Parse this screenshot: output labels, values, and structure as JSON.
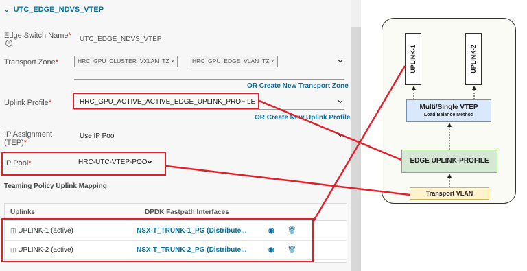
{
  "section": {
    "title": "UTC_EDGE_NDVS_VTEP"
  },
  "form": {
    "edge_switch_name": {
      "label": "Edge Switch Name",
      "value": "UTC_EDGE_NDVS_VTEP"
    },
    "transport_zone": {
      "label": "Transport Zone",
      "chips": [
        "HRC_GPU_CLUSTER_VXLAN_TZ",
        "HRC_GPU_EDGE_VLAN_TZ"
      ],
      "create_link": "OR Create New Transport Zone"
    },
    "uplink_profile": {
      "label": "Uplink Profile",
      "value": "HRC_GPU_ACTIVE_ACTIVE_EDGE_UPLINK_PROFILE",
      "create_link": "OR Create New Uplink Profile"
    },
    "ip_assignment": {
      "label_line1": "IP Assignment",
      "label_line2": "(TEP)",
      "value": "Use IP Pool"
    },
    "ip_pool": {
      "label": "IP Pool",
      "value": "HRC-UTC-VTEP-POO"
    },
    "required_mark": "*"
  },
  "teaming": {
    "title": "Teaming Policy Uplink Mapping",
    "headers": {
      "uplinks": "Uplinks",
      "interfaces": "DPDK Fastpath Interfaces"
    },
    "rows": [
      {
        "uplink": "UPLINK-1 (active)",
        "interface": "NSX-T_TRUNK-1_PG (Distribute..."
      },
      {
        "uplink": "UPLINK-2 (active)",
        "interface": "NSX-T_TRUNK-2_PG (Distribute..."
      }
    ]
  },
  "diagram": {
    "uplink1": "UPLINK-1",
    "uplink2": "UPLINK-2",
    "vtep_title": "Multi/Single VTEP",
    "vtep_sub": "Load Balance Method",
    "profile": "EDGE UPLINK-PROFILE",
    "vlan": "Transport VLAN"
  },
  "colors": {
    "link": "#0072a3",
    "required": "#c21d00",
    "highlight": "#e0202a"
  }
}
